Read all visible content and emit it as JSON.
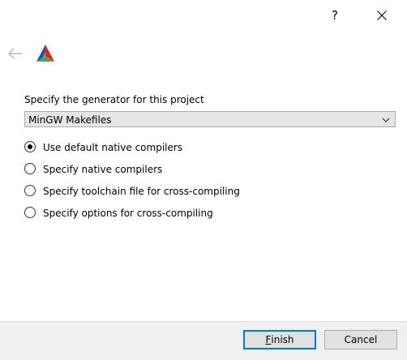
{
  "titlebar": {
    "help_label": "?"
  },
  "generator": {
    "label": "Specify the generator for this project",
    "selected": "MinGW Makefiles"
  },
  "options": [
    {
      "label": "Use default native compilers",
      "checked": true
    },
    {
      "label": "Specify native compilers",
      "checked": false
    },
    {
      "label": "Specify toolchain file for cross-compiling",
      "checked": false
    },
    {
      "label": "Specify options for cross-compiling",
      "checked": false
    }
  ],
  "buttons": {
    "finish_mnemonic": "F",
    "finish_rest": "inish",
    "cancel": "Cancel"
  },
  "colors": {
    "accent": "#0078d7",
    "footer": "#f0f0f0"
  }
}
